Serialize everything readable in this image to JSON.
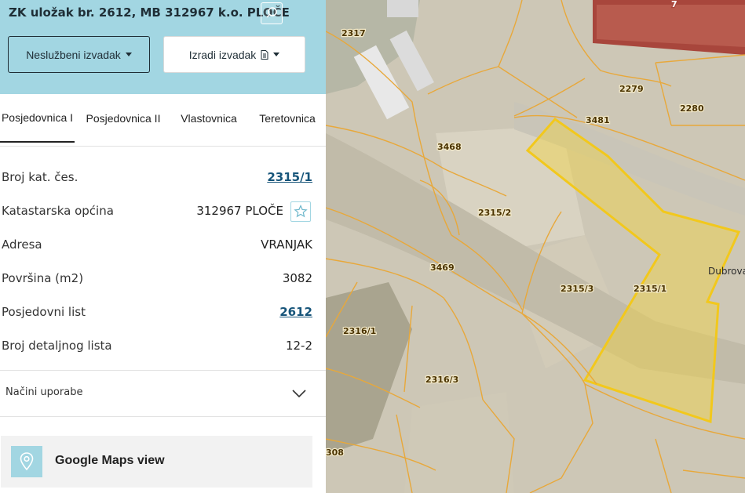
{
  "panel": {
    "title": "ZK uložak br. 2612, MB 312967 k.o. PLOČE",
    "buttons": {
      "neluzbeni": "Neslužbeni izvadak",
      "izradi": "Izradi izvadak"
    },
    "tabs": [
      "Posjedovnica I",
      "Posjedovnica II",
      "Vlastovnica",
      "Teretovnica"
    ],
    "active_tab": "Posjedovnica I",
    "details": {
      "broj_kat_ces": {
        "label": "Broj kat. čes.",
        "value": "2315/1"
      },
      "katastarska_opcina": {
        "label": "Katastarska općina",
        "value": "312967 PLOČE"
      },
      "adresa": {
        "label": "Adresa",
        "value": "VRANJAK"
      },
      "povrsina": {
        "label": "Površina (m2)",
        "value": "3082"
      },
      "posjedovni_list": {
        "label": "Posjedovni list",
        "value": "2612"
      },
      "broj_detaljnog_lista": {
        "label": "Broj detaljnog lista",
        "value": "12-2"
      }
    },
    "nacini_uporabe": "Načini uporabe",
    "google_maps": "Google Maps view"
  },
  "map": {
    "parcel_labels": [
      "2317",
      "2279",
      "2280",
      "3481",
      "3468",
      "2315/2",
      "3469",
      "2315/3",
      "2315/1",
      "2316/1",
      "2316/3",
      "308",
      "7"
    ],
    "street_label": "Dubrova",
    "highlight_color": "#f2d33a",
    "boundary_color": "#e8a83a"
  },
  "colors": {
    "header_bg": "#a2d6e2",
    "text_dark": "#1f2e36",
    "link": "#17557a"
  }
}
